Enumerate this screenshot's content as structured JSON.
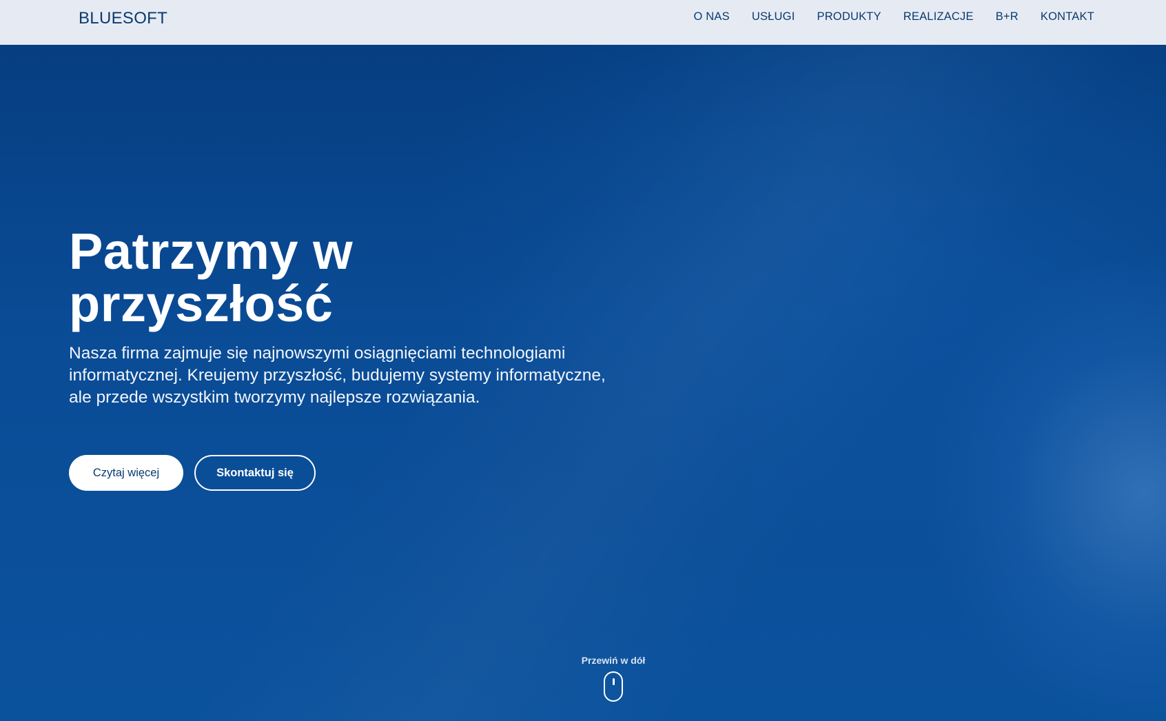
{
  "header": {
    "logo": "BLUESOFT",
    "nav": [
      {
        "label": "O NAS"
      },
      {
        "label": "USŁUGI"
      },
      {
        "label": "PRODUKTY"
      },
      {
        "label": "REALIZACJE"
      },
      {
        "label": "B+R"
      },
      {
        "label": "KONTAKT"
      }
    ]
  },
  "hero": {
    "title_line1": "Patrzymy w",
    "title_line2": "przyszłość",
    "description": "Nasza firma zajmuje się najnowszymi osiągnięciami technologiami informatycznej. Kreujemy przyszłość, budujemy systemy informatyczne, ale przede wszystkim tworzymy najlepsze rozwiązania.",
    "primary_button": "Czytaj więcej",
    "secondary_button": "Skontaktuj się",
    "scroll_label": "Przewiń w dół",
    "scroll_icon": "mouse-icon"
  },
  "colors": {
    "header_bg": "#e6ebf3",
    "brand_text": "#0b3a6f",
    "hero_bg": "#0b4a93",
    "hero_text": "#ffffff"
  }
}
